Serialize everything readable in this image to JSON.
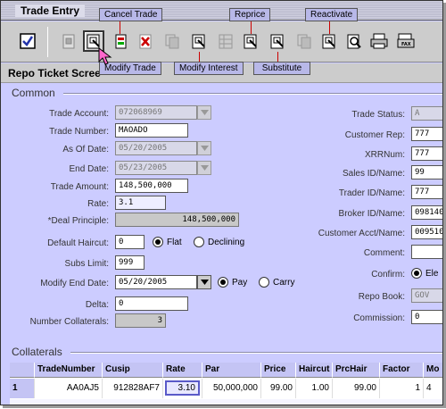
{
  "window": {
    "title": "Trade Entry"
  },
  "toolbar": {
    "callouts": {
      "cancel_trade": "Cancel Trade",
      "reprice": "Reprice",
      "reactivate": "Reactivate",
      "modify_trade": "Modify Trade",
      "modify_interest": "Modify Interest",
      "substitute": "Substitute"
    },
    "icons": [
      "checkbox-icon",
      "new-ticket-icon",
      "modify-trade-icon",
      "cancel-trade-icon",
      "delete-icon",
      "copy-icon",
      "modify-interest-icon",
      "grid-icon",
      "reprice-icon",
      "substitute-icon",
      "copy-icon",
      "reactivate-icon",
      "view-icon",
      "printer-icon",
      "fax-icon"
    ]
  },
  "screen": {
    "title": "Repo Ticket Scree"
  },
  "sections": {
    "common": "Common",
    "collaterals": "Collaterals"
  },
  "common_left": {
    "trade_account": {
      "label": "Trade Account:",
      "value": "072068969"
    },
    "trade_number": {
      "label": "Trade Number:",
      "value": "MAOADO"
    },
    "as_of_date": {
      "label": "As Of Date:",
      "value": "05/20/2005"
    },
    "end_date": {
      "label": "End Date:",
      "value": "05/23/2005"
    },
    "trade_amount": {
      "label": "Trade Amount:",
      "value": "148,500,000"
    },
    "rate": {
      "label": "Rate:",
      "value": "3.1"
    },
    "deal_principle": {
      "label": "*Deal Principle:",
      "value": "148,500,000"
    },
    "default_haircut": {
      "label": "Default Haircut:",
      "value": "0",
      "opt1": "Flat",
      "opt2": "Declining"
    },
    "subs_limit": {
      "label": "Subs Limit:",
      "value": "999"
    },
    "modify_end_date": {
      "label": "Modify End Date:",
      "value": "05/20/2005",
      "opt1": "Pay",
      "opt2": "Carry"
    },
    "delta": {
      "label": "Delta:",
      "value": "0"
    },
    "number_collaterals": {
      "label": "Number Collaterals:",
      "value": "3"
    }
  },
  "common_right": {
    "trade_status": {
      "label": "Trade Status:",
      "value": "A"
    },
    "customer_rep": {
      "label": "Customer Rep:",
      "value": "777"
    },
    "xrrnum": {
      "label": "XRRNum:",
      "value": "777"
    },
    "sales_id": {
      "label": "Sales ID/Name:",
      "value": "99"
    },
    "trader_id": {
      "label": "Trader ID/Name:",
      "value": "777"
    },
    "broker_id": {
      "label": "Broker ID/Name:",
      "value": "098140"
    },
    "customer_acct": {
      "label": "Customer Acct/Name:",
      "value": "009510"
    },
    "comment": {
      "label": "Comment:",
      "value": ""
    },
    "confirm": {
      "label": "Confirm:",
      "value": "Ele"
    },
    "repo_book": {
      "label": "Repo Book:",
      "value": "GOV"
    },
    "commission": {
      "label": "Commission:",
      "value": "0"
    }
  },
  "collaterals_table": {
    "columns": [
      "TradeNumber",
      "Cusip",
      "Rate",
      "Par",
      "Price",
      "Haircut",
      "PrcHair",
      "Factor",
      "Mo"
    ],
    "rows": [
      [
        "1",
        "AA0AJ5",
        "912828AF7",
        "3.10",
        "50,000,000",
        "99.00",
        "1.00",
        "99.00",
        "1",
        "4"
      ]
    ]
  }
}
